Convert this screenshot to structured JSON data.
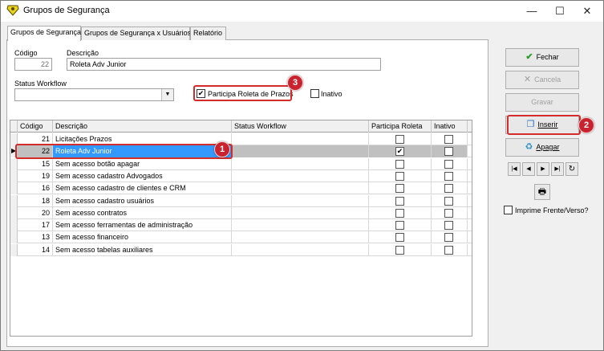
{
  "window": {
    "title": "Grupos de Segurança",
    "controls": {
      "minimize": "—",
      "maximize": "☐",
      "close": "✕"
    }
  },
  "tabs": [
    {
      "label": "Grupos de Segurança",
      "active": true
    },
    {
      "label": "Grupos de Segurança x Usuários",
      "active": false
    },
    {
      "label": "Relatório",
      "active": false
    }
  ],
  "form": {
    "codigo_label": "Código",
    "codigo_value": "22",
    "descricao_label": "Descrição",
    "descricao_value": "Roleta Adv Junior",
    "status_label": "Status Workflow",
    "status_value": "",
    "participa_label": "Participa Roleta de Prazos",
    "participa_checked": true,
    "inativo_label": "Inativo",
    "inativo_checked": false
  },
  "grid": {
    "columns": [
      "Código",
      "Descrição",
      "Status Workflow",
      "Participa Roleta",
      "Inativo"
    ],
    "rows": [
      {
        "codigo": "21",
        "descricao": "Licitações Prazos",
        "status": "",
        "participa": false,
        "inativo": false,
        "selected": false
      },
      {
        "codigo": "22",
        "descricao": "Roleta Adv Junior",
        "status": "",
        "participa": true,
        "inativo": false,
        "selected": true
      },
      {
        "codigo": "15",
        "descricao": "Sem acesso botão apagar",
        "status": "",
        "participa": false,
        "inativo": false,
        "selected": false
      },
      {
        "codigo": "19",
        "descricao": "Sem acesso cadastro Advogados",
        "status": "",
        "participa": false,
        "inativo": false,
        "selected": false
      },
      {
        "codigo": "16",
        "descricao": "Sem acesso cadastro de clientes e CRM",
        "status": "",
        "participa": false,
        "inativo": false,
        "selected": false
      },
      {
        "codigo": "18",
        "descricao": "Sem acesso cadastro usuários",
        "status": "",
        "participa": false,
        "inativo": false,
        "selected": false
      },
      {
        "codigo": "20",
        "descricao": "Sem acesso contratos",
        "status": "",
        "participa": false,
        "inativo": false,
        "selected": false
      },
      {
        "codigo": "17",
        "descricao": "Sem acesso ferramentas de administração",
        "status": "",
        "participa": false,
        "inativo": false,
        "selected": false
      },
      {
        "codigo": "13",
        "descricao": "Sem acesso financeiro",
        "status": "",
        "participa": false,
        "inativo": false,
        "selected": false
      },
      {
        "codigo": "14",
        "descricao": "Sem acesso tabelas auxiliares",
        "status": "",
        "participa": false,
        "inativo": false,
        "selected": false
      }
    ]
  },
  "sidebar": {
    "fechar": "Fechar",
    "cancela": "Cancela",
    "gravar": "Gravar",
    "inserir": "Inserir",
    "apagar": "Apagar",
    "nav": {
      "first": "|◀",
      "prev": "◀",
      "next": "▶",
      "last": "▶|",
      "refresh": "↻"
    },
    "print_icon": "🖶",
    "imprime_label": "Imprime Frente/Verso?",
    "imprime_checked": false
  },
  "callouts": [
    "1",
    "2",
    "3"
  ],
  "colors": {
    "selection": "#3399ff",
    "callout": "#c8232e",
    "accent_green": "#2a9d2a"
  }
}
